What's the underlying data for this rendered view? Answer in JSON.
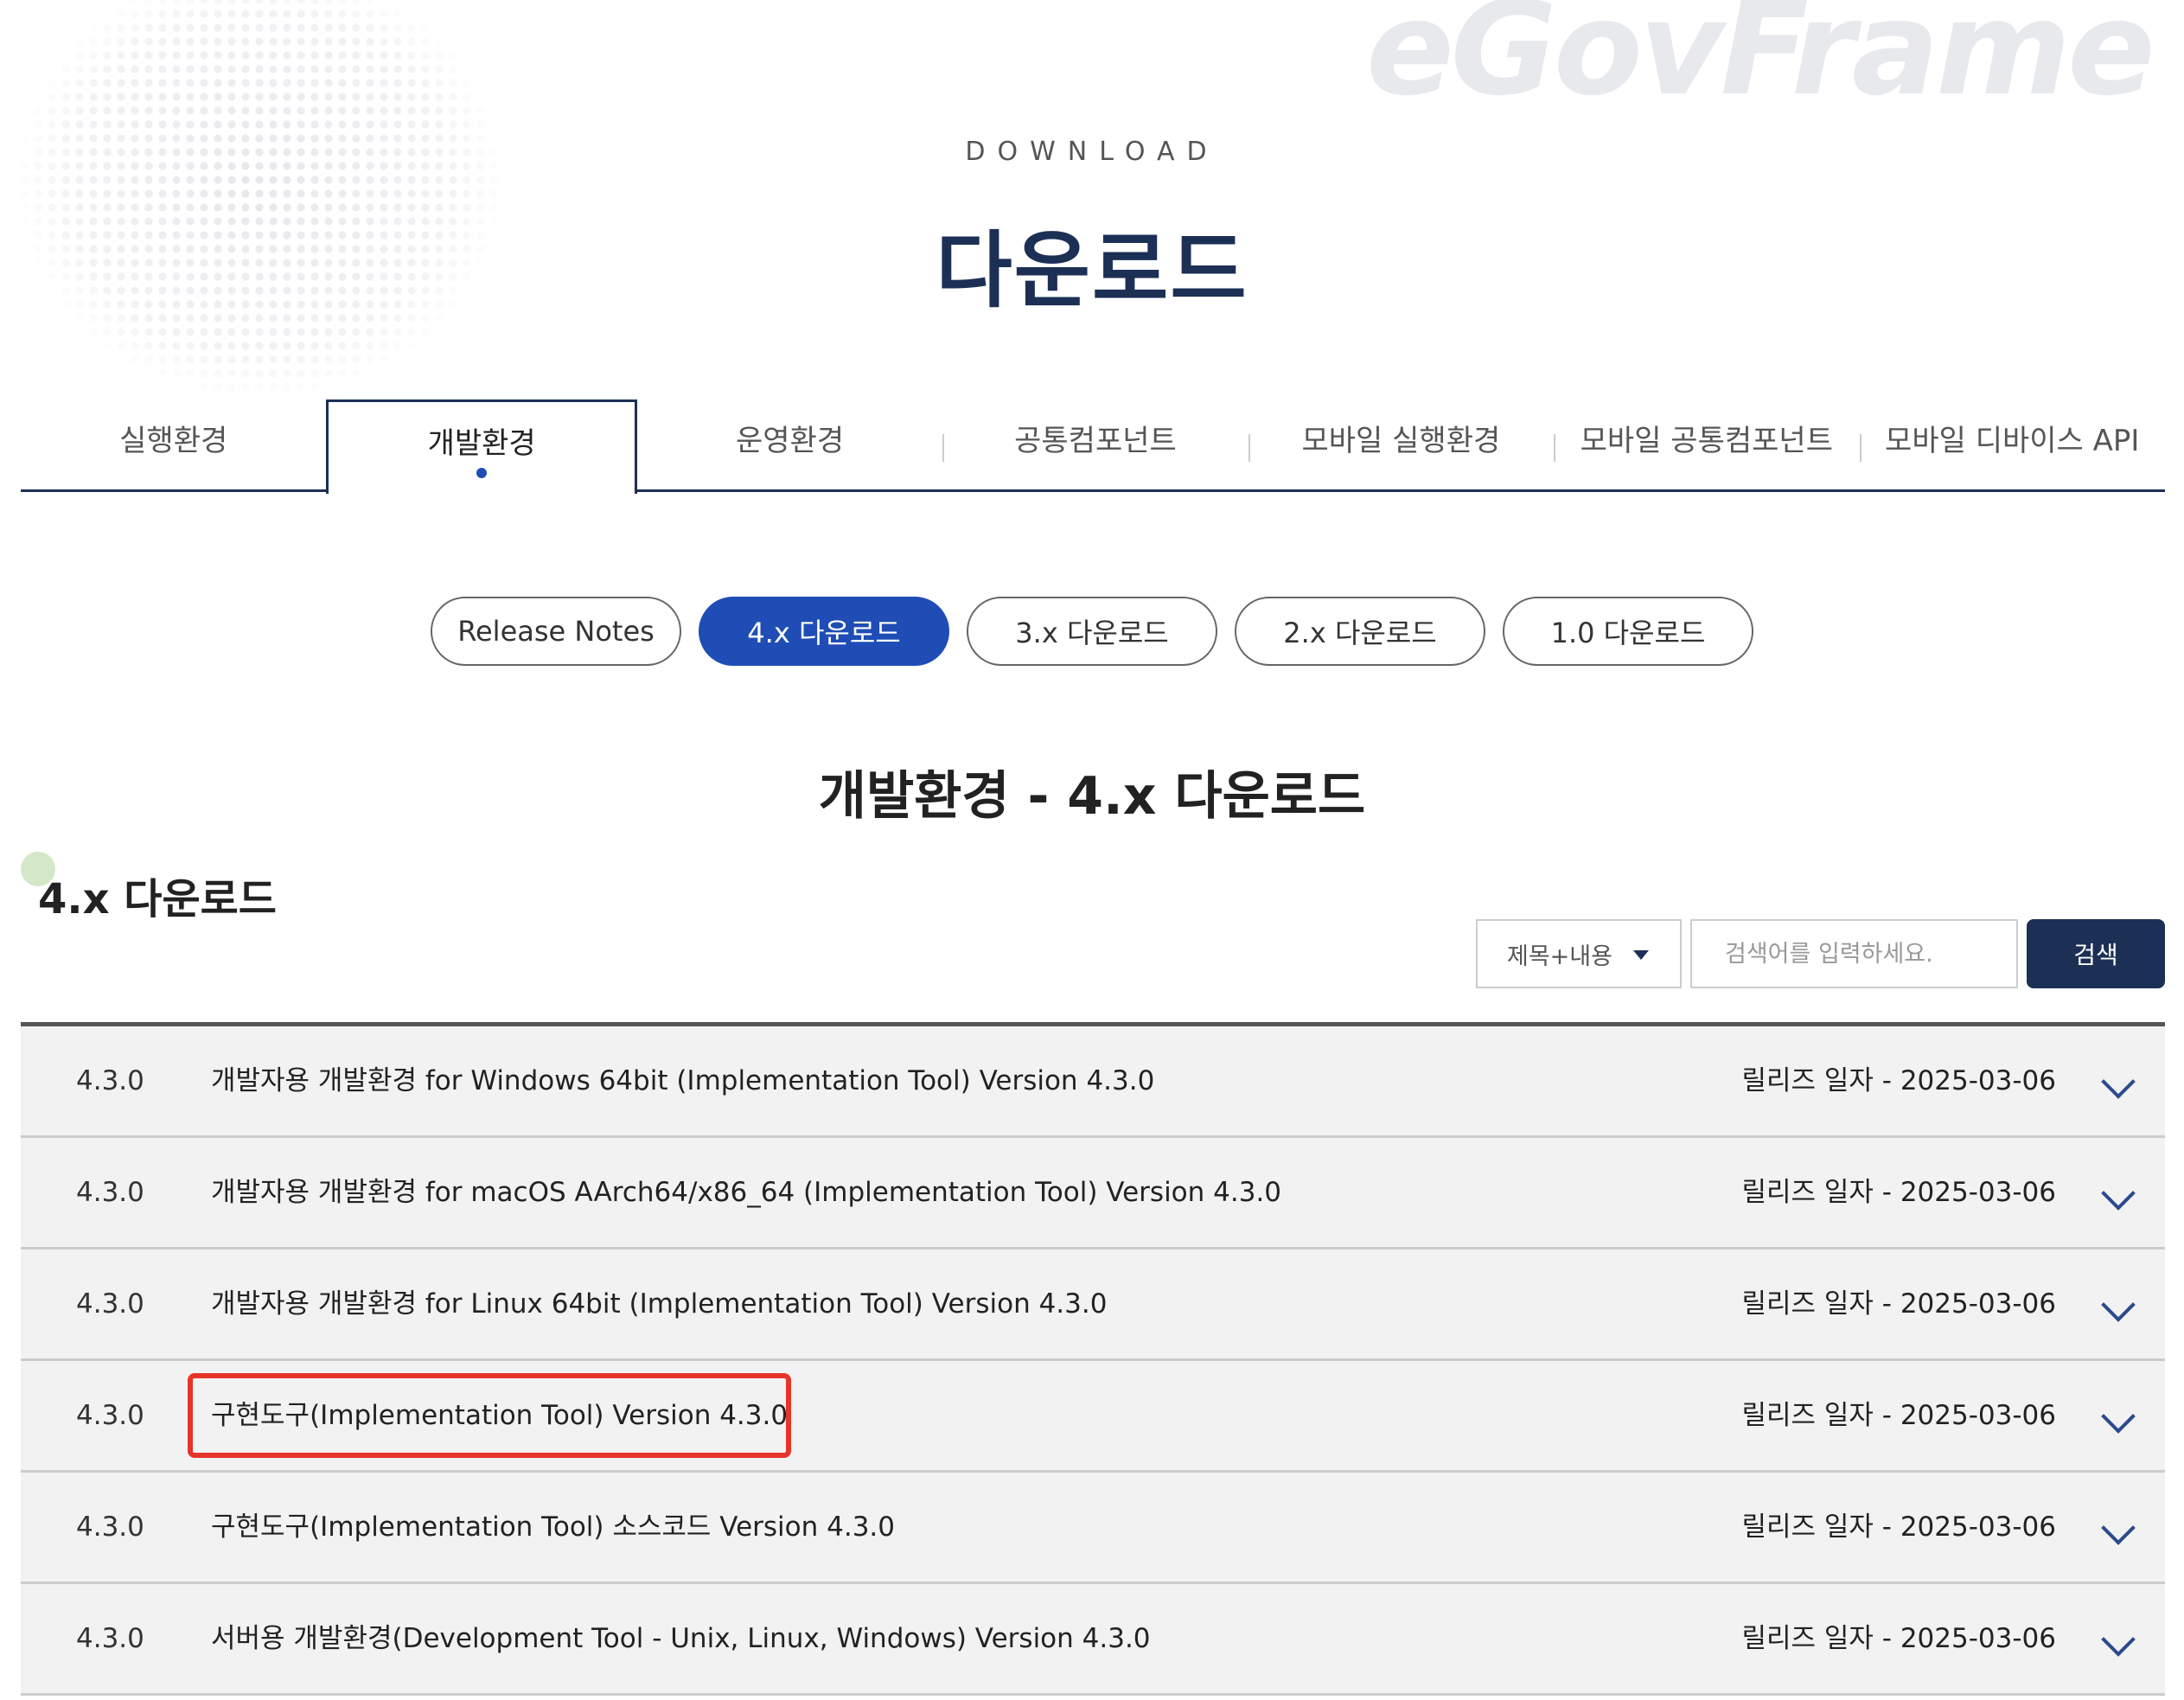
{
  "watermark": "eGovFrame",
  "header": {
    "eyebrow": "DOWNLOAD",
    "title": "다운로드"
  },
  "tabs": [
    {
      "label": "실행환경",
      "active": false
    },
    {
      "label": "개발환경",
      "active": true
    },
    {
      "label": "운영환경",
      "active": false
    },
    {
      "label": "공통컴포넌트",
      "active": false
    },
    {
      "label": "모바일 실행환경",
      "active": false
    },
    {
      "label": "모바일 공통컴포넌트",
      "active": false
    },
    {
      "label": "모바일 디바이스 API",
      "active": false
    }
  ],
  "pills": [
    {
      "label": "Release Notes",
      "active": false
    },
    {
      "label": "4.x 다운로드",
      "active": true
    },
    {
      "label": "3.x 다운로드",
      "active": false
    },
    {
      "label": "2.x 다운로드",
      "active": false
    },
    {
      "label": "1.0 다운로드",
      "active": false
    }
  ],
  "section_title": "개발환경 - 4.x 다운로드",
  "sub_title": "4.x 다운로드",
  "search": {
    "select_value": "제목+내용",
    "placeholder": "검색어를 입력하세요.",
    "value": "",
    "button_label": "검색"
  },
  "rows": [
    {
      "version": "4.3.0",
      "title": "개발자용 개발환경 for Windows 64bit (Implementation Tool) Version 4.3.0",
      "date": "릴리즈 일자 - 2025-03-06",
      "highlighted": false
    },
    {
      "version": "4.3.0",
      "title": "개발자용 개발환경 for macOS AArch64/x86_64 (Implementation Tool) Version 4.3.0",
      "date": "릴리즈 일자 - 2025-03-06",
      "highlighted": false
    },
    {
      "version": "4.3.0",
      "title": "개발자용 개발환경 for Linux 64bit (Implementation Tool) Version 4.3.0",
      "date": "릴리즈 일자 - 2025-03-06",
      "highlighted": false
    },
    {
      "version": "4.3.0",
      "title": "구현도구(Implementation Tool) Version 4.3.0",
      "date": "릴리즈 일자 - 2025-03-06",
      "highlighted": true
    },
    {
      "version": "4.3.0",
      "title": "구현도구(Implementation Tool) 소스코드 Version 4.3.0",
      "date": "릴리즈 일자 - 2025-03-06",
      "highlighted": false
    },
    {
      "version": "4.3.0",
      "title": "서버용 개발환경(Development Tool - Unix, Linux, Windows) Version 4.3.0",
      "date": "릴리즈 일자 - 2025-03-06",
      "highlighted": false
    }
  ],
  "colors": {
    "brand_navy": "#1c2f55",
    "accent_blue": "#1f4db5",
    "highlight_red": "#e6342a",
    "row_bg": "#f2f2f2"
  }
}
